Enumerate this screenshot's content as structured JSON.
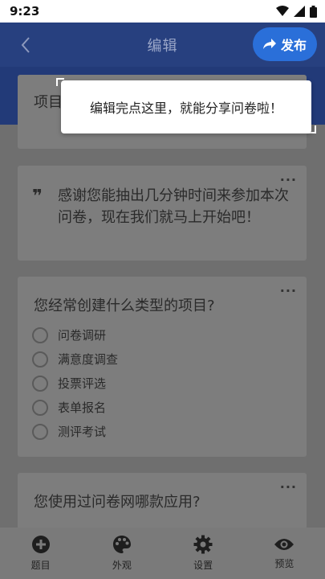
{
  "status_bar": {
    "time": "9:23"
  },
  "header": {
    "title": "编辑",
    "publish_label": "发布"
  },
  "tooltip": {
    "text": "编辑完点这里，就能分享问卷啦！"
  },
  "cards": {
    "project": {
      "title": "项目"
    },
    "intro": {
      "text": "感谢您能抽出几分钟时间来参加本次问卷，现在我们就马上开始吧！"
    },
    "q1": {
      "title": "您经常创建什么类型的项目?",
      "options": [
        "问卷调研",
        "满意度调查",
        "投票评选",
        "表单报名",
        "测评考试"
      ]
    },
    "q2": {
      "title": "您使用过问卷网哪款应用?"
    },
    "more_label": "···"
  },
  "bottom_nav": {
    "items": [
      {
        "label": "题目",
        "icon": "plus-circle-icon"
      },
      {
        "label": "外观",
        "icon": "palette-icon"
      },
      {
        "label": "设置",
        "icon": "gear-icon"
      },
      {
        "label": "预览",
        "icon": "eye-icon"
      }
    ]
  }
}
